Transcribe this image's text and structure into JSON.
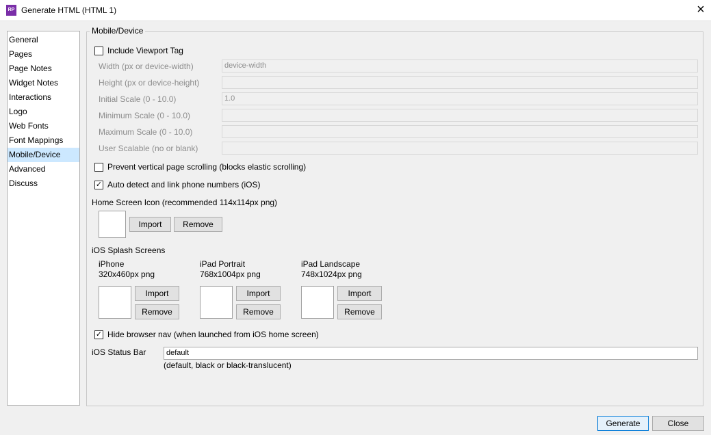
{
  "window": {
    "title": "Generate HTML (HTML 1)",
    "app_icon": "RP",
    "close_icon": "×"
  },
  "nav": {
    "items": [
      {
        "label": "General"
      },
      {
        "label": "Pages"
      },
      {
        "label": "Page Notes"
      },
      {
        "label": "Widget Notes"
      },
      {
        "label": "Interactions"
      },
      {
        "label": "Logo"
      },
      {
        "label": "Web Fonts"
      },
      {
        "label": "Font Mappings"
      },
      {
        "label": "Mobile/Device",
        "selected": true
      },
      {
        "label": "Advanced"
      },
      {
        "label": "Discuss"
      }
    ]
  },
  "panel": {
    "legend": "Mobile/Device",
    "include_viewport": {
      "label": "Include Viewport Tag",
      "checked": false
    },
    "fields": [
      {
        "label": "Width (px or device-width)",
        "value": "device-width"
      },
      {
        "label": "Height (px or device-height)",
        "value": ""
      },
      {
        "label": "Initial Scale (0 - 10.0)",
        "value": "1.0"
      },
      {
        "label": "Minimum Scale (0 - 10.0)",
        "value": ""
      },
      {
        "label": "Maximum Scale (0 - 10.0)",
        "value": ""
      },
      {
        "label": "User Scalable (no or blank)",
        "value": ""
      }
    ],
    "prevent_scrolling": {
      "label": "Prevent vertical page scrolling (blocks elastic scrolling)",
      "checked": false
    },
    "auto_detect_phone": {
      "label": "Auto detect and link phone numbers (iOS)",
      "checked": true
    },
    "home_screen_icon": {
      "label": "Home Screen Icon (recommended 114x114px png)",
      "import_label": "Import",
      "remove_label": "Remove"
    },
    "splash": {
      "label": "iOS Splash Screens",
      "items": [
        {
          "name": "iPhone",
          "size": "320x460px png",
          "import_label": "Import",
          "remove_label": "Remove"
        },
        {
          "name": "iPad Portrait",
          "size": "768x1004px png",
          "import_label": "Import",
          "remove_label": "Remove"
        },
        {
          "name": "iPad Landscape",
          "size": "748x1024px png",
          "import_label": "Import",
          "remove_label": "Remove"
        }
      ]
    },
    "hide_browser_nav": {
      "label": "Hide browser nav (when launched from iOS home screen)",
      "checked": true
    },
    "status_bar": {
      "label": "iOS Status Bar",
      "value": "default",
      "hint": "(default, black or black-translucent)"
    }
  },
  "footer": {
    "generate_label": "Generate",
    "close_label": "Close"
  },
  "check_mark": "✓"
}
